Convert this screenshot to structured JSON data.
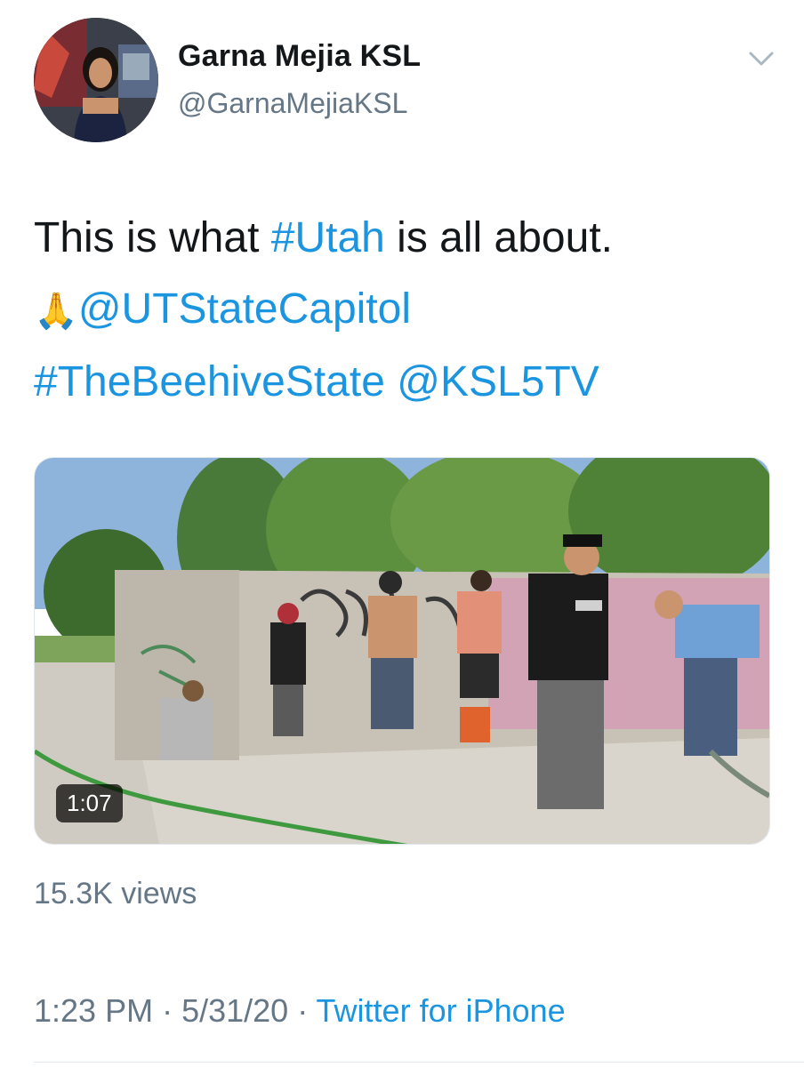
{
  "author": {
    "display_name": "Garna Mejia KSL",
    "handle": "@GarnaMejiaKSL"
  },
  "tweet": {
    "text_pre": "This is what ",
    "hashtag_utah": "#Utah",
    "text_post": " is all about.",
    "emoji": "🙏",
    "mention_capitol": "@UTStateCapitol",
    "hashtag_beehive": "#TheBeehiveState",
    "mention_ksl": "@KSL5TV"
  },
  "media": {
    "duration": "1:07"
  },
  "stats": {
    "views": "15.3K views"
  },
  "meta": {
    "time": "1:23 PM",
    "sep1": " · ",
    "date": "5/31/20",
    "sep2": " · ",
    "source": "Twitter for iPhone"
  },
  "icons": {
    "caret": "chevron-down-icon"
  },
  "colors": {
    "link": "#1b95e0",
    "secondary_text": "#657786",
    "primary_text": "#14171a"
  }
}
